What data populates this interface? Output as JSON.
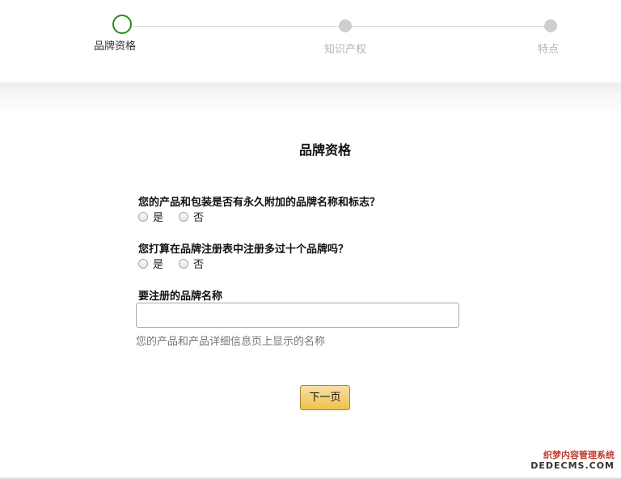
{
  "stepper": {
    "steps": [
      {
        "label": "品牌资格",
        "state": "active"
      },
      {
        "label": "知识产权",
        "state": "inactive"
      },
      {
        "label": "特点",
        "state": "inactive"
      }
    ],
    "active_color": "#2d8a1f",
    "inactive_color": "#cfcfcf"
  },
  "form": {
    "title": "品牌资格",
    "questions": [
      {
        "text": "您的产品和包装是否有永久附加的品牌名称和标志？",
        "options": [
          "是",
          "否"
        ]
      },
      {
        "text": "您打算在品牌注册表中注册多过十个品牌吗？",
        "options": [
          "是",
          "否"
        ]
      }
    ],
    "brand_name": {
      "label": "要注册的品牌名称",
      "value": "",
      "hint": "您的产品和产品详细信息页上显示的名称"
    },
    "next_label": "下一页"
  },
  "watermark": {
    "line1": "织梦内容管理系统",
    "line2": "DEDECMS.COM"
  }
}
